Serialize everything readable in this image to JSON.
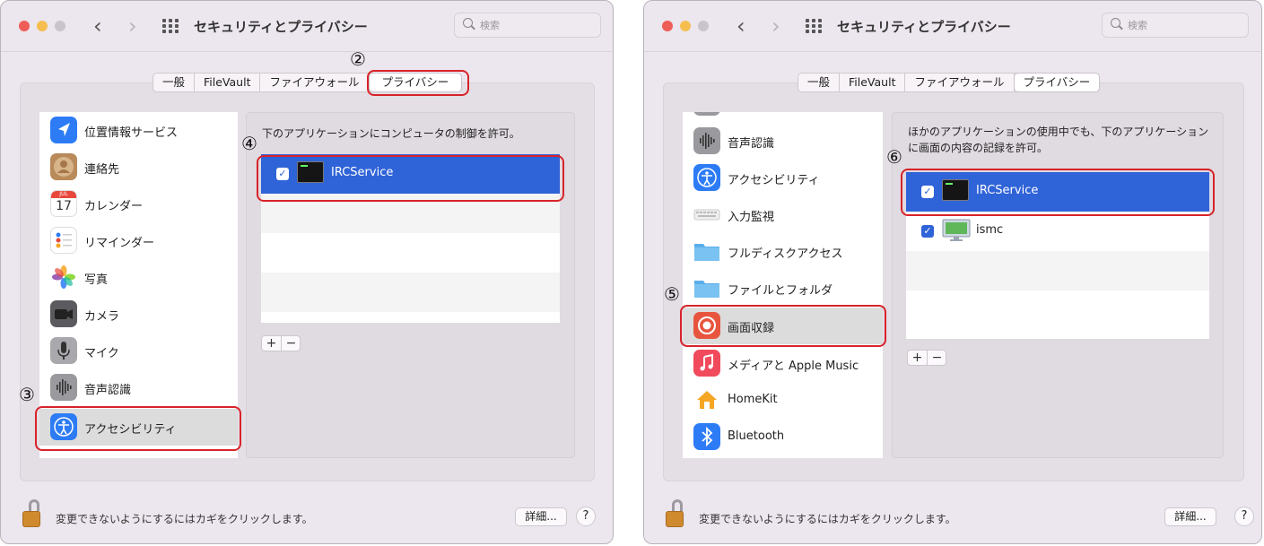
{
  "windows": [
    {
      "title": "セキュリティとプライバシー",
      "search_placeholder": "検索",
      "tabs": [
        "一般",
        "FileVault",
        "ファイアウォール",
        "プライバシー"
      ],
      "services": [
        {
          "label": "位置情報サービス",
          "icon": "location-arrow-icon"
        },
        {
          "label": "連絡先",
          "icon": "contacts-icon"
        },
        {
          "label": "カレンダー",
          "icon": "calendar-icon",
          "calendar_month": "JUL",
          "calendar_day": "17"
        },
        {
          "label": "リマインダー",
          "icon": "reminders-icon"
        },
        {
          "label": "写真",
          "icon": "photos-icon"
        },
        {
          "label": "カメラ",
          "icon": "camera-icon"
        },
        {
          "label": "マイク",
          "icon": "microphone-icon"
        },
        {
          "label": "音声認識",
          "icon": "waveform-icon"
        },
        {
          "label": "アクセシビリティ",
          "icon": "accessibility-icon"
        }
      ],
      "description": "下のアプリケーションにコンピュータの制御を許可。",
      "apps": [
        {
          "name": "IRCService",
          "checked": true
        }
      ],
      "add_label": "+",
      "remove_label": "−",
      "lock_text": "変更できないようにするにはカギをクリックします。",
      "advanced_label": "詳細...",
      "help_label": "?"
    },
    {
      "title": "セキュリティとプライバシー",
      "search_placeholder": "検索",
      "tabs": [
        "一般",
        "FileVault",
        "ファイアウォール",
        "プライバシー"
      ],
      "services": [
        {
          "label": "音声認識",
          "icon": "waveform-icon"
        },
        {
          "label": "アクセシビリティ",
          "icon": "accessibility-icon"
        },
        {
          "label": "入力監視",
          "icon": "keyboard-icon"
        },
        {
          "label": "フルディスクアクセス",
          "icon": "folder-icon"
        },
        {
          "label": "ファイルとフォルダ",
          "icon": "folder-icon"
        },
        {
          "label": "画面収録",
          "icon": "screen-recording-icon"
        },
        {
          "label": "メディアと Apple Music",
          "icon": "music-note-icon"
        },
        {
          "label": "HomeKit",
          "icon": "home-icon"
        },
        {
          "label": "Bluetooth",
          "icon": "bluetooth-icon"
        }
      ],
      "description": "ほかのアプリケーションの使用中でも、下のアプリケーションに画面の内容の記録を許可。",
      "apps": [
        {
          "name": "IRCService",
          "checked": true
        },
        {
          "name": "ismc",
          "checked": true
        }
      ],
      "add_label": "+",
      "remove_label": "−",
      "lock_text": "変更できないようにするにはカギをクリックします。",
      "advanced_label": "詳細...",
      "help_label": "?"
    }
  ],
  "annotations": {
    "step2": "②",
    "step3": "③",
    "step4": "④",
    "step5": "⑤",
    "step6": "⑥"
  },
  "colors": {
    "highlight": "#d8232a",
    "selection": "#2f63d8"
  }
}
